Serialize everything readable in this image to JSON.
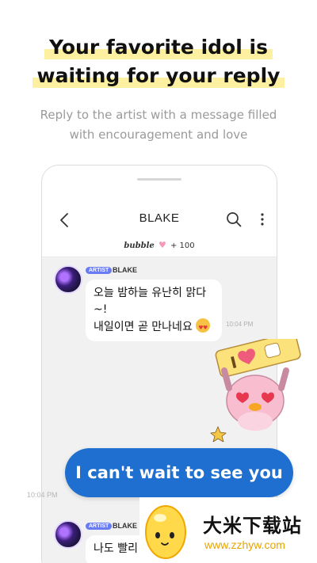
{
  "headline": {
    "line1": "Your favorite idol is",
    "line2": "waiting for your reply"
  },
  "subtitle": {
    "line1": "Reply to the artist with a message filled",
    "line2": "with encouragement and love"
  },
  "app": {
    "title": "BLAKE",
    "bubble_label": "bubble",
    "bubble_count": "+ 100",
    "icons": [
      "chevron-left-icon",
      "search-icon",
      "more-vertical-icon"
    ]
  },
  "messages": [
    {
      "badge": "ARTIST",
      "sender": "BLAKE",
      "line1": "오늘 밤하늘 유난히 맑다~!",
      "line2": "내일이면 곧 만나네요",
      "time": "10:04 PM"
    },
    {
      "badge": "ARTIST",
      "sender": "BLAKE",
      "line1": "나도 빨리"
    }
  ],
  "reply": {
    "text": "I can't wait to see you",
    "time": "10:04 PM"
  },
  "watermark": {
    "title": "大米下载站",
    "url": "www.zzhyw.com"
  },
  "colors": {
    "highlight": "#fdf0a0",
    "reply_bubble": "#1f6fd0",
    "artist_badge": "#6a7cf4",
    "watermark_url": "#e6a400"
  }
}
